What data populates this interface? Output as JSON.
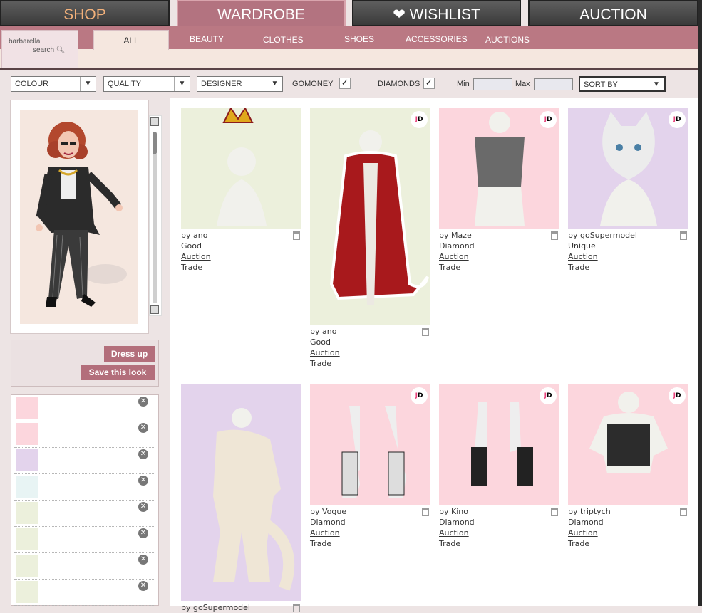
{
  "top_tabs": [
    {
      "label": "SHOP"
    },
    {
      "label": "WARDROBE"
    },
    {
      "label": "WISHLIST",
      "icon": "heart-icon"
    },
    {
      "label": "AUCTION"
    }
  ],
  "user": {
    "name": "barbarella",
    "search_label": "search"
  },
  "sub_tabs": [
    "ALL",
    "BEAUTY",
    "CLOTHES",
    "SHOES",
    "ACCESSORIES",
    "AUCTIONS"
  ],
  "filters": {
    "colour": "COLOUR",
    "quality": "QUALITY",
    "designer": "DESIGNER",
    "gomoney_label": "GOMONEY",
    "gomoney_checked": "✓",
    "diamonds_label": "DIAMONDS",
    "diamonds_checked": "✓",
    "min_label": "Min",
    "max_label": "Max",
    "sort_by": "SORT BY"
  },
  "actions": {
    "dress_up": "Dress up",
    "save_look": "Save this look"
  },
  "colors": {
    "accent": "#b36e7b",
    "tab_active": "#b37380",
    "bg_pink": "#fcd6dd",
    "bg_green": "#ecf0dc",
    "bg_lilac": "#e3d3ec"
  },
  "worn_items": [
    {
      "name": "body-thumb",
      "bg": "#fcd6dd"
    },
    {
      "name": "head-thumb",
      "bg": "#fcd6dd"
    },
    {
      "name": "eyes-thumb",
      "bg": "#e3d3ec"
    },
    {
      "name": "jacket-thumb",
      "bg": "#e8f4f4"
    },
    {
      "name": "blank-thumb",
      "bg": "#ecf0dc"
    },
    {
      "name": "necklace-thumb",
      "bg": "#ecf0dc"
    },
    {
      "name": "pants-thumb",
      "bg": "#ecf0dc"
    },
    {
      "name": "sunglasses-thumb",
      "bg": "#ecf0dc"
    }
  ],
  "products": [
    {
      "by": "by ano",
      "quality": "Good",
      "auction": "Auction",
      "trade": "Trade",
      "bg": "#ecf0dc",
      "badge": false,
      "item": "crown"
    },
    {
      "by": "by ano",
      "quality": "Good",
      "auction": "Auction",
      "trade": "Trade",
      "bg": "#ecf0dc",
      "badge": true,
      "item": "royal-cape"
    },
    {
      "by": "by Maze",
      "quality": "Diamond",
      "auction": "Auction",
      "trade": "Trade",
      "bg": "#fcd6dd",
      "badge": true,
      "item": "grey-top"
    },
    {
      "by": "by goSupermodel",
      "quality": "Unique",
      "auction": "Auction",
      "trade": "Trade",
      "bg": "#e3d3ec",
      "badge": true,
      "item": "cat-head"
    },
    {
      "by": "by goSupermodel",
      "quality": "",
      "auction": "",
      "trade": "",
      "bg": "#e3d3ec",
      "badge": false,
      "item": "fur-suit"
    },
    {
      "by": "by Vogue",
      "quality": "Diamond",
      "auction": "Auction",
      "trade": "Trade",
      "bg": "#fcd6dd",
      "badge": true,
      "item": "platform-boots"
    },
    {
      "by": "by Kino",
      "quality": "Diamond",
      "auction": "Auction",
      "trade": "Trade",
      "bg": "#fcd6dd",
      "badge": true,
      "item": "combat-boots"
    },
    {
      "by": "by triptych",
      "quality": "Diamond",
      "auction": "Auction",
      "trade": "Trade",
      "bg": "#fcd6dd",
      "badge": true,
      "item": "corset"
    }
  ]
}
